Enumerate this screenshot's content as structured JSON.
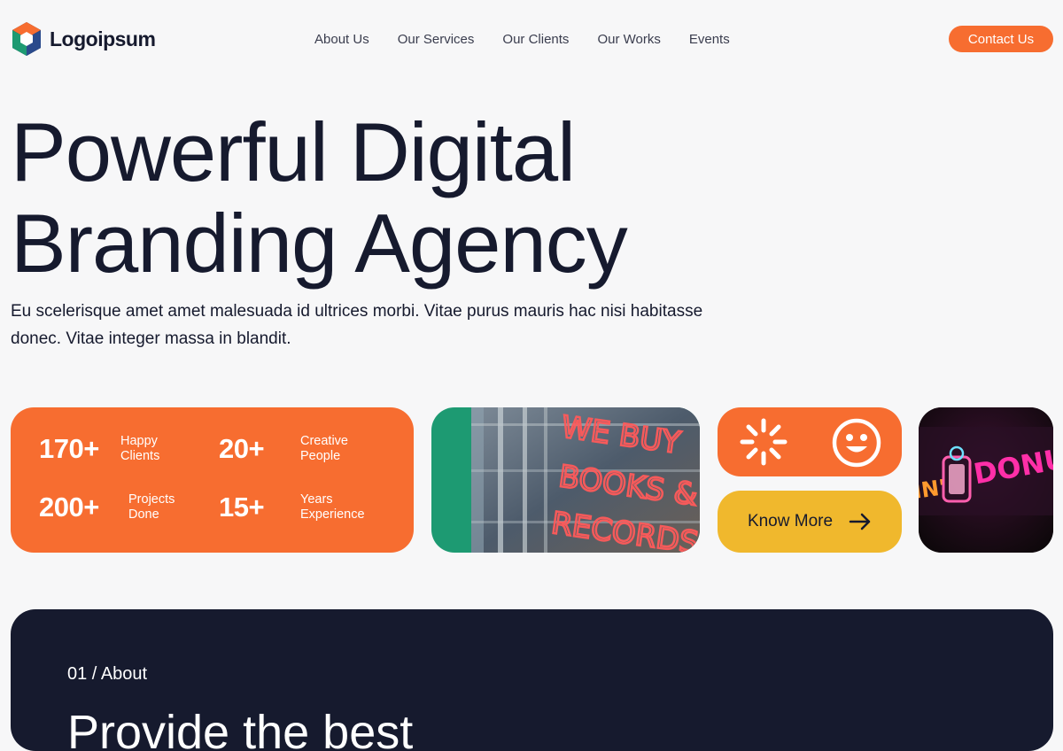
{
  "brand": {
    "name": "Logoipsum"
  },
  "nav": {
    "items": [
      {
        "label": "About Us"
      },
      {
        "label": "Our Services"
      },
      {
        "label": "Our Clients"
      },
      {
        "label": "Our Works"
      },
      {
        "label": "Events"
      }
    ]
  },
  "header": {
    "contact_label": "Contact Us"
  },
  "hero": {
    "title_line1": "Powerful Digital",
    "title_line2": "Branding Agency",
    "description": "Eu scelerisque amet amet malesuada id ultrices morbi. Vitae purus mauris hac nisi habitasse donec. Vitae integer massa in blandit."
  },
  "stats": [
    {
      "value": "170+",
      "label": "Happy\nClients"
    },
    {
      "value": "20+",
      "label": "Creative\nPeople"
    },
    {
      "value": "200+",
      "label": "Projects\nDone"
    },
    {
      "value": "15+",
      "label": "Years\nExperience"
    }
  ],
  "images": {
    "neon_sign_text": "WE BUY BOOKS & RECORDS",
    "donut_sign_text": "IN' DONUT"
  },
  "cta": {
    "know_more_label": "Know More"
  },
  "about": {
    "label": "01 / About",
    "heading_partial": "Provide the best"
  },
  "colors": {
    "accent": "#f76d30",
    "dark": "#161a2e",
    "yellow": "#f0b82d",
    "green": "#1d9a72",
    "background": "#f7f7f8"
  }
}
